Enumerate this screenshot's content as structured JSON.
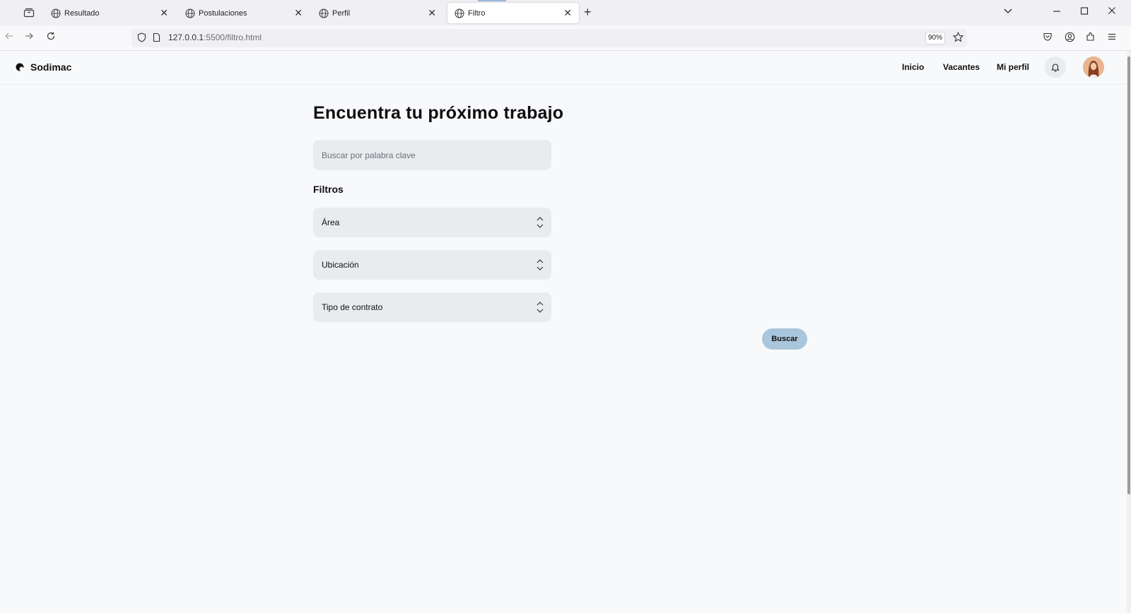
{
  "browser": {
    "tabs": [
      {
        "label": "Resultado",
        "active": false
      },
      {
        "label": "Postulaciones",
        "active": false
      },
      {
        "label": "Perfil",
        "active": false
      },
      {
        "label": "Filtro",
        "active": true
      }
    ],
    "url": {
      "host": "127.0.0.1",
      "path": ":5500/filtro.html"
    },
    "zoom": "90%"
  },
  "site": {
    "brand": "Sodimac",
    "nav": {
      "inicio": "Inicio",
      "vacantes": "Vacantes",
      "perfil": "Mi perfil"
    }
  },
  "main": {
    "title": "Encuentra tu próximo trabajo",
    "search": {
      "placeholder": "Buscar por palabra clave",
      "value": ""
    },
    "filters_label": "Filtros",
    "filters": [
      {
        "label": "Área"
      },
      {
        "label": "Ubicación"
      },
      {
        "label": "Tipo de contrato"
      }
    ],
    "search_button": "Buscar"
  },
  "colors": {
    "accent_button": "#a9c6dc",
    "field_bg": "#e9ecef",
    "page_bg": "#f8f9fb"
  }
}
